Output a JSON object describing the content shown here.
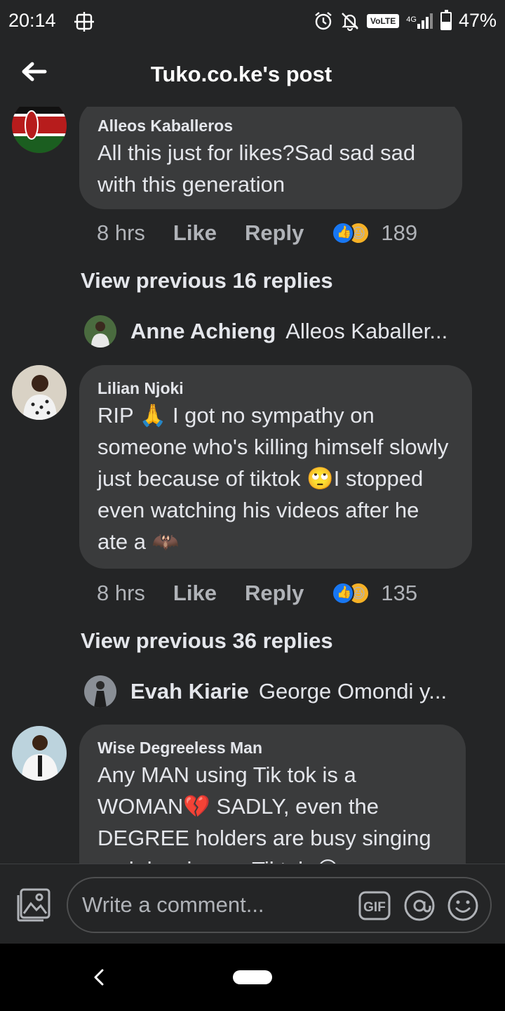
{
  "status_bar": {
    "time": "20:14",
    "network_label": "VoLTE",
    "network_type": "4G",
    "battery": "47%"
  },
  "header": {
    "title": "Tuko.co.ke's post"
  },
  "comments": [
    {
      "author": "Alleos Kaballeros",
      "text": "All this just for likes?Sad sad sad with this generation",
      "time": "8 hrs",
      "like_label": "Like",
      "reply_label": "Reply",
      "reaction_count": "189",
      "view_previous": "View previous 16 replies",
      "reply_preview": {
        "name": "Anne Achieng",
        "text": "Alleos Kaballer..."
      }
    },
    {
      "author": "Lilian Njoki",
      "text_parts": [
        "RIP ",
        "🙏",
        " I got no sympathy on someone who's killing himself slowly just because of tiktok ",
        "🙄",
        "I stopped even watching his videos after he ate a ",
        "🦇"
      ],
      "time": "8 hrs",
      "like_label": "Like",
      "reply_label": "Reply",
      "reaction_count": "135",
      "view_previous": "View previous 36 replies",
      "reply_preview": {
        "name": "Evah Kiarie",
        "text": "George Omondi  y..."
      }
    },
    {
      "author": "Wise Degreeless Man",
      "text_parts": [
        "Any MAN using Tik tok is a WOMAN",
        "💔",
        " SADLY, even the DEGREE holders are busy singing and dancing on Tiktok ",
        "😂"
      ]
    }
  ],
  "composer": {
    "placeholder": "Write a comment...",
    "gif_label": "GIF"
  },
  "colors": {
    "background": "#242526",
    "bubble": "#3a3b3c",
    "text_primary": "#e4e6eb",
    "text_secondary": "#b0b3b8",
    "like_blue": "#1877f2",
    "haha_yellow": "#f7b125"
  }
}
